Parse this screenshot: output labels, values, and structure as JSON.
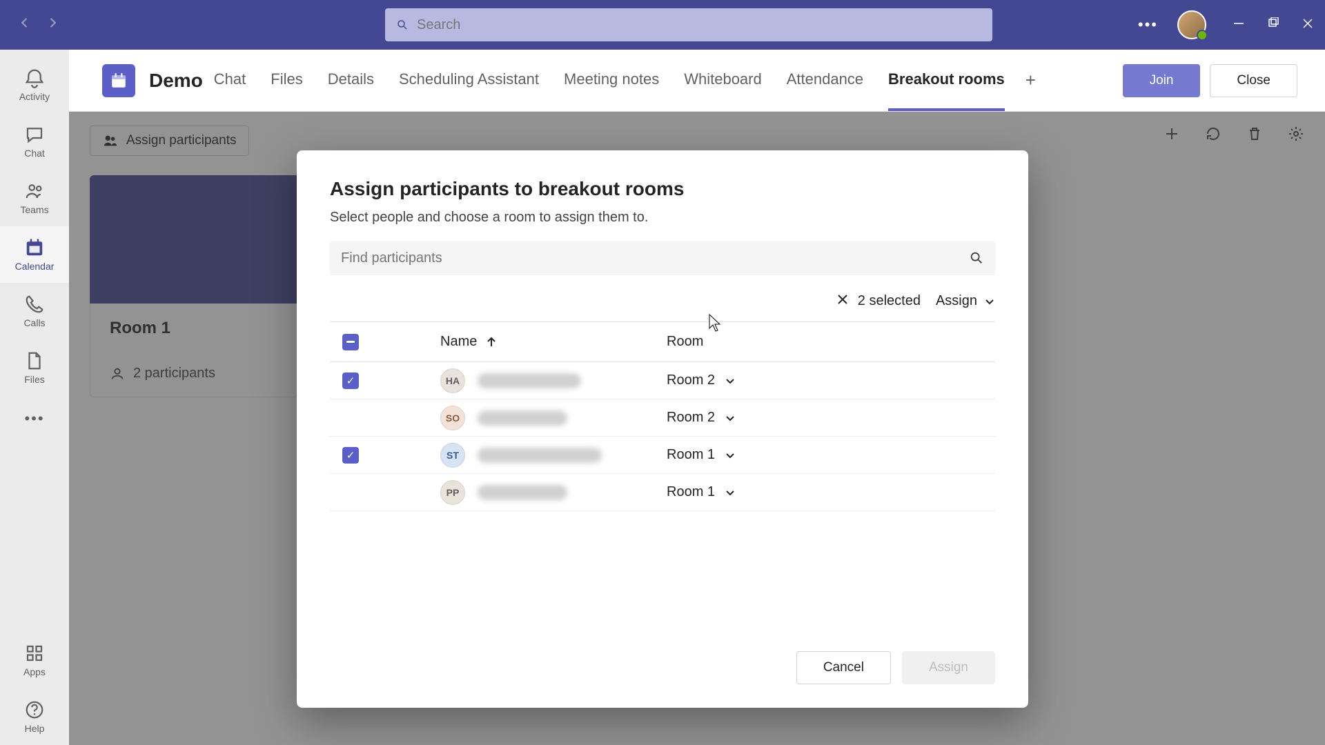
{
  "titlebar": {
    "search_placeholder": "Search"
  },
  "rail": {
    "items": [
      {
        "key": "activity",
        "label": "Activity"
      },
      {
        "key": "chat",
        "label": "Chat"
      },
      {
        "key": "teams",
        "label": "Teams"
      },
      {
        "key": "calendar",
        "label": "Calendar"
      },
      {
        "key": "calls",
        "label": "Calls"
      },
      {
        "key": "files",
        "label": "Files"
      }
    ],
    "bottom": [
      {
        "key": "apps",
        "label": "Apps"
      },
      {
        "key": "help",
        "label": "Help"
      }
    ],
    "active": "calendar"
  },
  "header": {
    "meeting_title": "Demo",
    "tabs": [
      "Chat",
      "Files",
      "Details",
      "Scheduling Assistant",
      "Meeting notes",
      "Whiteboard",
      "Attendance",
      "Breakout rooms"
    ],
    "active_tab": "Breakout rooms",
    "join_label": "Join",
    "close_label": "Close"
  },
  "page": {
    "assign_button": "Assign participants",
    "room_title": "Room 1",
    "participant_count_label": "2 participants"
  },
  "modal": {
    "title": "Assign participants to breakout rooms",
    "subtitle": "Select people and choose a room to assign them to.",
    "find_placeholder": "Find participants",
    "selected_text": "2 selected",
    "assign_dropdown_label": "Assign",
    "columns": {
      "name": "Name",
      "room": "Room"
    },
    "participants": [
      {
        "initials": "HA",
        "avatar_bg": "#e8e4dc",
        "avatar_fg": "#5f5f5f",
        "name_width": 150,
        "room": "Room 2",
        "checked": true
      },
      {
        "initials": "SO",
        "avatar_bg": "#f4e2d8",
        "avatar_fg": "#8a5a3a",
        "name_width": 130,
        "room": "Room 2",
        "checked": false
      },
      {
        "initials": "ST",
        "avatar_bg": "#d6e4f5",
        "avatar_fg": "#3a5a8a",
        "name_width": 180,
        "room": "Room 1",
        "checked": true
      },
      {
        "initials": "PP",
        "avatar_bg": "#e8e4dc",
        "avatar_fg": "#5f5f5f",
        "name_width": 130,
        "room": "Room 1",
        "checked": false
      }
    ],
    "footer": {
      "cancel": "Cancel",
      "assign": "Assign"
    }
  }
}
